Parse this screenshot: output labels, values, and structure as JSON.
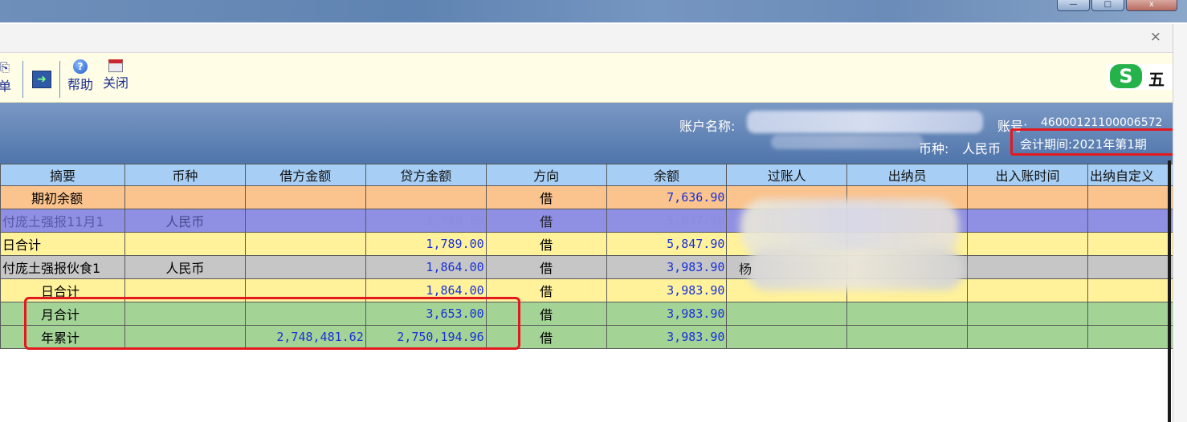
{
  "window": {
    "min_glyph": "—",
    "max_glyph": "□",
    "close_glyph": "x",
    "doc_close_glyph": "×"
  },
  "toolbar": {
    "partial_label": "单",
    "help_label": "帮助",
    "close_label": "关闭"
  },
  "info": {
    "account_name_label": "账户名称:",
    "account_no_label": "账号:",
    "account_no": "46000121100006572",
    "currency_label": "币种:",
    "currency": "人民币",
    "period_label": "会计期间:",
    "period": "2021年第1期"
  },
  "ime": {
    "logo": "S",
    "label": "五"
  },
  "table": {
    "headers": [
      "摘要",
      "币种",
      "借方金额",
      "贷方金额",
      "方向",
      "余额",
      "过账人",
      "出纳员",
      "出入账时间",
      "出纳自定义"
    ],
    "rows": [
      {
        "summary": "期初余额",
        "currency": "",
        "debit": "",
        "credit": "",
        "direction": "借",
        "balance": "7,636.90"
      },
      {
        "summary": "付庞土强报11月1",
        "currency": "人民币",
        "debit": "",
        "credit": "1,789.00",
        "direction": "借",
        "balance": "5,847.90"
      },
      {
        "summary": "日合计",
        "currency": "",
        "debit": "",
        "credit": "1,789.00",
        "direction": "借",
        "balance": "5,847.90"
      },
      {
        "summary": "付庞土强报伙食1",
        "currency": "人民币",
        "debit": "",
        "credit": "1,864.00",
        "direction": "借",
        "balance": "3,983.90"
      },
      {
        "summary": "日合计",
        "currency": "",
        "debit": "",
        "credit": "1,864.00",
        "direction": "借",
        "balance": "3,983.90"
      },
      {
        "summary": "月合计",
        "currency": "",
        "debit": "",
        "credit": "3,653.00",
        "direction": "借",
        "balance": "3,983.90"
      },
      {
        "summary": "年累计",
        "currency": "",
        "debit": "2,748,481.62",
        "credit": "2,750,194.96",
        "direction": "借",
        "balance": "3,983.90"
      }
    ],
    "poster_partial_char": "杨"
  },
  "colors": {
    "highlight": "#e3191f",
    "header_bg": "#a7cff5",
    "opening_row": "#fbc38d",
    "purple_row": "#8f8fe3",
    "yellow_row": "#fff29a",
    "gray_row": "#c6c6c6",
    "green_row": "#a3d496",
    "amount_text": "#1830d8"
  }
}
